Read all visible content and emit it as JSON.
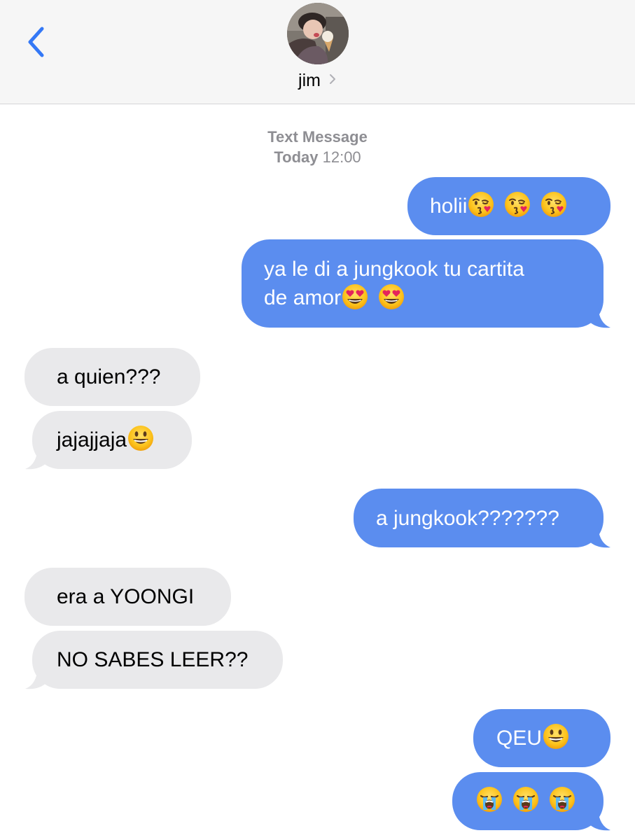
{
  "header": {
    "contact_name": "jim",
    "icons": {
      "back": "chevron-left-icon",
      "avatar": "contact-avatar-photo",
      "name_chevron": "chevron-right-icon"
    }
  },
  "thread_meta": {
    "service": "Text Message",
    "day": "Today",
    "time": "12:00"
  },
  "colors": {
    "outgoing_bubble": "#5b8def",
    "incoming_bubble": "#e9e9eb",
    "back_chevron": "#3478f6",
    "meta_text": "#8e8e93"
  },
  "messages": [
    {
      "direction": "outgoing",
      "text": "holii",
      "emojis": [
        "kissing-heart-emoji",
        "kissing-heart-emoji",
        "kissing-heart-emoji"
      ]
    },
    {
      "direction": "outgoing",
      "lines": [
        "ya le di a jungkook tu cartita",
        "de amor"
      ],
      "emojis": [
        "heart-eyes-emoji",
        "heart-eyes-emoji"
      ]
    },
    {
      "direction": "incoming",
      "text": "a quien???"
    },
    {
      "direction": "incoming",
      "text": "jajajjaja",
      "emojis": [
        "grinning-face-emoji"
      ]
    },
    {
      "direction": "outgoing",
      "text": "a jungkook???????"
    },
    {
      "direction": "incoming",
      "text": "era a YOONGI"
    },
    {
      "direction": "incoming",
      "text": "NO SABES LEER??"
    },
    {
      "direction": "outgoing",
      "text": "QEU",
      "emojis": [
        "grinning-face-emoji"
      ]
    },
    {
      "direction": "outgoing",
      "text": "",
      "emojis": [
        "loudly-crying-face-emoji",
        "loudly-crying-face-emoji",
        "loudly-crying-face-emoji"
      ]
    }
  ]
}
